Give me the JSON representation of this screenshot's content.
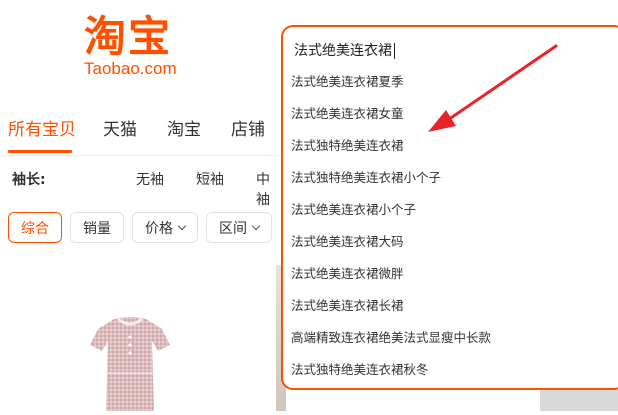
{
  "logo": {
    "cn": "淘宝",
    "en": "Taobao.com"
  },
  "search": {
    "query": "法式绝美连衣裙"
  },
  "suggestions": [
    "法式绝美连衣裙夏季",
    "法式绝美连衣裙女童",
    "法式独特绝美连衣裙",
    "法式独特绝美连衣裙小个子",
    "法式绝美连衣裙小个子",
    "法式绝美连衣裙大码",
    "法式绝美连衣裙微胖",
    "法式绝美连衣裙长裙",
    "高端精致连衣裙绝美法式显瘦中长款",
    "法式独特绝美连衣裙秋冬"
  ],
  "tabs": [
    "所有宝贝",
    "天猫",
    "淘宝",
    "店铺"
  ],
  "filter": {
    "label": "袖长:",
    "options": [
      "无袖",
      "短袖",
      "中袖"
    ]
  },
  "sort": [
    "综合",
    "销量",
    "价格",
    "区间"
  ],
  "colors": {
    "accent": "#ff5000",
    "arrow": "#e8232a"
  }
}
